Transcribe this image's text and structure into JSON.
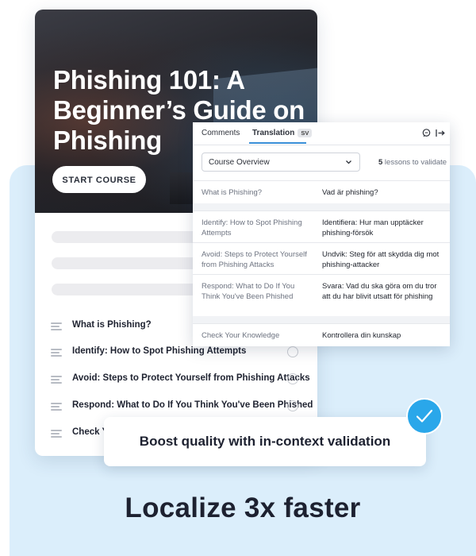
{
  "course": {
    "title": "Phishing 101: A Beginner’s Guide on Phishing",
    "start_button": "START COURSE",
    "lessons": [
      {
        "label": "What is Phishing?"
      },
      {
        "label": "Identify: How to Spot Phishing Attempts"
      },
      {
        "label": "Avoid: Steps to Protect Yourself from Phishing Attacks"
      },
      {
        "label": "Respond: What to Do If You Think You've Been Phished"
      },
      {
        "label": "Check Yo"
      }
    ]
  },
  "panel": {
    "tabs": {
      "comments": "Comments",
      "translation": "Translation",
      "lang_badge": "SV"
    },
    "icons": [
      "comment-icon",
      "exit-icon"
    ],
    "dropdown": {
      "value": "Course Overview"
    },
    "lessons_count": "5",
    "lessons_suffix": " lessons to validate",
    "rows": [
      {
        "source": "What is Phishing?",
        "target": "Vad är phishing?"
      },
      {
        "source": "Identify: How to Spot Phishing Attempts",
        "target": "Identifiera: Hur man upptäcker phishing-försök"
      },
      {
        "source": "Avoid: Steps to Protect Yourself from Phishing Attacks",
        "target": "Undvik: Steg för att skydda dig mot phishing-attacker"
      },
      {
        "source": "Respond: What to Do If You Think You've Been Phished",
        "target": "Svara: Vad du ska göra om du tror att du har blivit utsatt för phishing"
      },
      {
        "source": "Check Your Knowledge",
        "target": "Kontrollera din kunskap"
      }
    ]
  },
  "callout": {
    "text": "Boost quality with in-context validation"
  },
  "headline": "Localize 3x faster",
  "colors": {
    "accent": "#2aa7ea",
    "panel_bg": "#dbeefb",
    "tab_underline": "#3a8fd8"
  }
}
